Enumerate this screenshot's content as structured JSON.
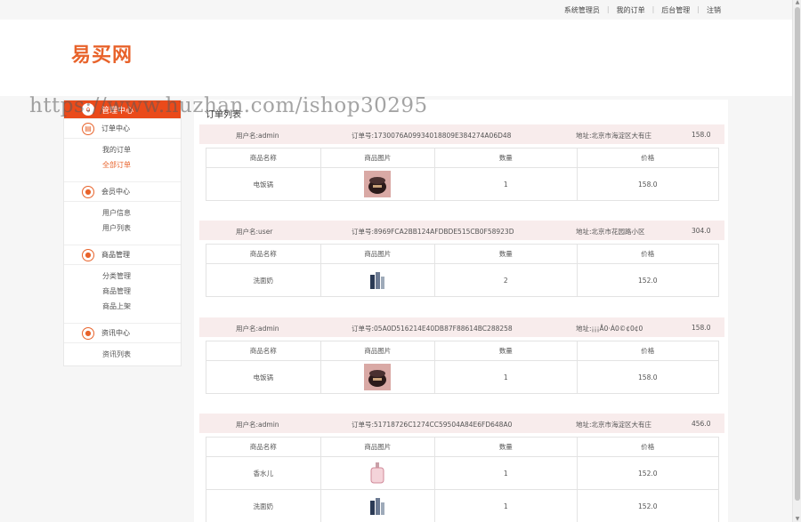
{
  "topbar": {
    "links": [
      "系统管理员",
      "我的订单",
      "后台管理",
      "注销"
    ]
  },
  "header": {
    "logo": "易买网"
  },
  "watermark": "https://www.huzhan.com/ishop30295",
  "sidebar": {
    "head": "管理中心",
    "sections": [
      {
        "title": "订单中心",
        "icon": "order-icon",
        "items": [
          "我的订单",
          "全部订单"
        ],
        "active": 1
      },
      {
        "title": "会员中心",
        "icon": "user-icon",
        "items": [
          "用户信息",
          "用户列表"
        ]
      },
      {
        "title": "商品管理",
        "icon": "goods-icon",
        "items": [
          "分类管理",
          "商品管理",
          "商品上架"
        ]
      },
      {
        "title": "资讯中心",
        "icon": "news-icon",
        "items": [
          "资讯列表"
        ]
      }
    ]
  },
  "main": {
    "title": "订单列表",
    "table_headers": [
      "商品名称",
      "商品图片",
      "数量",
      "价格"
    ],
    "orders": [
      {
        "user": "用户名:admin",
        "order_no": "订单号:1730076A09934018809E384274A06D48",
        "address": "地址:北京市海淀区大有庄",
        "total": "158.0",
        "items": [
          {
            "name": "电饭锅",
            "image": "rice-cooker",
            "qty": "1",
            "price": "158.0"
          }
        ]
      },
      {
        "user": "用户名:user",
        "order_no": "订单号:8969FCA2BB124AFDBDE515CB0F58923D",
        "address": "地址:北京市花园路小区",
        "total": "304.0",
        "items": [
          {
            "name": "洗面奶",
            "image": "cleanser",
            "qty": "2",
            "price": "152.0"
          }
        ]
      },
      {
        "user": "用户名:admin",
        "order_no": "订单号:05A0D516214E40DB87F88614BC288258",
        "address": "地址:¡¡¡Å0·Á0©¢0¢0",
        "total": "158.0",
        "items": [
          {
            "name": "电饭锅",
            "image": "rice-cooker",
            "qty": "1",
            "price": "158.0"
          }
        ]
      },
      {
        "user": "用户名:admin",
        "order_no": "订单号:51718726C1274CC59504A84E6FD648A0",
        "address": "地址:北京市海淀区大有庄",
        "total": "456.0",
        "items": [
          {
            "name": "香水儿",
            "image": "perfume",
            "qty": "1",
            "price": "152.0"
          },
          {
            "name": "洗面奶",
            "image": "cleanser",
            "qty": "1",
            "price": "152.0"
          }
        ]
      }
    ]
  }
}
